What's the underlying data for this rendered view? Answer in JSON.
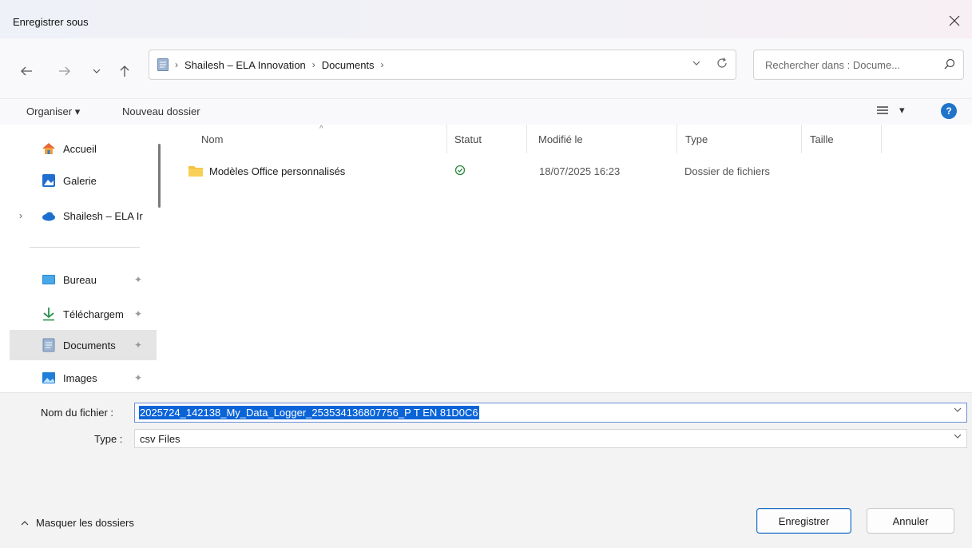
{
  "window": {
    "title": "Enregistrer sous"
  },
  "nav": {
    "breadcrumb": [
      "Shailesh – ELA Innovation",
      "Documents"
    ],
    "search_placeholder": "Rechercher dans : Docume..."
  },
  "toolbar": {
    "organize": "Organiser",
    "new_folder": "Nouveau dossier",
    "help": "?"
  },
  "sidebar": {
    "items": [
      {
        "label": "Accueil",
        "icon": "home-icon"
      },
      {
        "label": "Galerie",
        "icon": "gallery-icon"
      },
      {
        "label": "Shailesh – ELA Ir",
        "icon": "onedrive-cloud-icon"
      },
      {
        "label": "Bureau",
        "icon": "desktop-icon",
        "pinned": true
      },
      {
        "label": "Téléchargem",
        "icon": "download-icon",
        "pinned": true
      },
      {
        "label": "Documents",
        "icon": "documents-icon",
        "pinned": true,
        "selected": true
      },
      {
        "label": "Images",
        "icon": "images-icon",
        "pinned": true
      }
    ]
  },
  "columns": [
    "Nom",
    "Statut",
    "Modifié le",
    "Type",
    "Taille"
  ],
  "files": [
    {
      "name": "Modèles Office personnalisés",
      "status": "synced",
      "modified": "18/07/2025 16:23",
      "type": "Dossier de fichiers",
      "size": ""
    }
  ],
  "form": {
    "filename_label": "Nom du fichier :",
    "filename_value": "2025724_142138_My_Data_Logger_253534136807756_P T EN 81D0C6",
    "type_label": "Type :",
    "type_value": "csv Files"
  },
  "footer": {
    "hide_folders": "Masquer les dossiers",
    "save": "Enregistrer",
    "cancel": "Annuler"
  },
  "colors": {
    "accent": "#1e74c8",
    "selection": "#0a64d8",
    "folder": "#f5c040"
  }
}
